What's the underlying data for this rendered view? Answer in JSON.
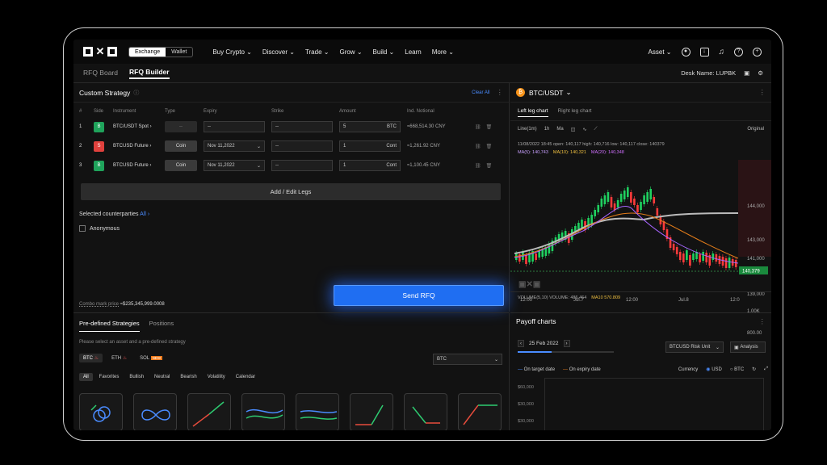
{
  "header": {
    "exchange": "Exchange",
    "wallet": "Wallet",
    "nav": [
      "Buy Crypto",
      "Discover",
      "Trade",
      "Grow",
      "Build",
      "Learn",
      "More"
    ],
    "asset": "Asset"
  },
  "subnav": {
    "tabs": [
      "RFQ Board",
      "RFQ Builder"
    ],
    "desk": "Desk Name: LUPBK"
  },
  "custom": {
    "title": "Custom Strategy",
    "clear": "Clear All",
    "cols": [
      "#",
      "Side",
      "Instrument",
      "Type",
      "Expiry",
      "Strike",
      "Amount",
      "Ind. Notional"
    ],
    "rows": [
      {
        "n": "1",
        "side": "B",
        "inst": "BTC/USDT Spot",
        "type": "--",
        "expiry": "--",
        "strike": "--",
        "amount": "5",
        "unit": "BTC",
        "notional": "≈668,514.30 CNY"
      },
      {
        "n": "2",
        "side": "S",
        "inst": "BTCUSD Future",
        "type": "Coin",
        "expiry": "Nov 11,2022",
        "strike": "--",
        "amount": "1",
        "unit": "Cont",
        "notional": "≈1,261.92 CNY"
      },
      {
        "n": "3",
        "side": "B",
        "inst": "BTCUSD Future",
        "type": "Coin",
        "expiry": "Nov 11,2022",
        "strike": "--",
        "amount": "1",
        "unit": "Cont",
        "notional": "≈1,100.45 CNY"
      }
    ],
    "add": "Add / Edit Legs",
    "counterparties": "Selected counterparties",
    "all": "All",
    "anon": "Anonymous",
    "combo_label": "Combo mark price",
    "combo": "≈$235,345,999.0008",
    "send": "Send RFQ"
  },
  "chart": {
    "pair": "BTC/USDT",
    "tabs": [
      "Left leg chart",
      "Right leg chart"
    ],
    "interval": "Line(1m)",
    "tf": "1h",
    "ma": "Ma",
    "original": "Original",
    "ohlc": "11/08/2022 18:45  open: 140,117  high: 140,716  low: 140,117  close: 140379",
    "ma5": "MA(5): 140,743",
    "ma10": "MA(10): 140,321",
    "ma20": "MA(20): 140,348",
    "prices": [
      "144,000",
      "143,000",
      "141,000",
      "139,000",
      "1.00K",
      "800.00"
    ],
    "last": "140,379",
    "volume": "VOLUME(5,10)  VOLUME: 486.464",
    "volma": "MA10 570.809",
    "times": [
      "12:00",
      "Jul.7",
      "12:00",
      "Jul.8",
      "12:0"
    ]
  },
  "strategies": {
    "tabs": [
      "Pre-defined Strategies",
      "Positions"
    ],
    "hint": "Please select an asset and a pre-defined strategy",
    "assets": [
      "BTC",
      "ETH",
      "SOL"
    ],
    "new": "NEW",
    "select": "BTC",
    "filters": [
      "All",
      "Favorites",
      "Bullish",
      "Neutral",
      "Bearish",
      "Volatility",
      "Calendar"
    ]
  },
  "payoff": {
    "title": "Payoff charts",
    "date": "25 Feb 2022",
    "unit": "BTCUSD Risk Unit",
    "analysis": "Analysis",
    "target": "On target date",
    "expiry": "On expiry date",
    "currency": "Currency",
    "usd": "USD",
    "btc": "BTC",
    "yticks": [
      "$60,000",
      "$30,000",
      "$30,000"
    ]
  }
}
